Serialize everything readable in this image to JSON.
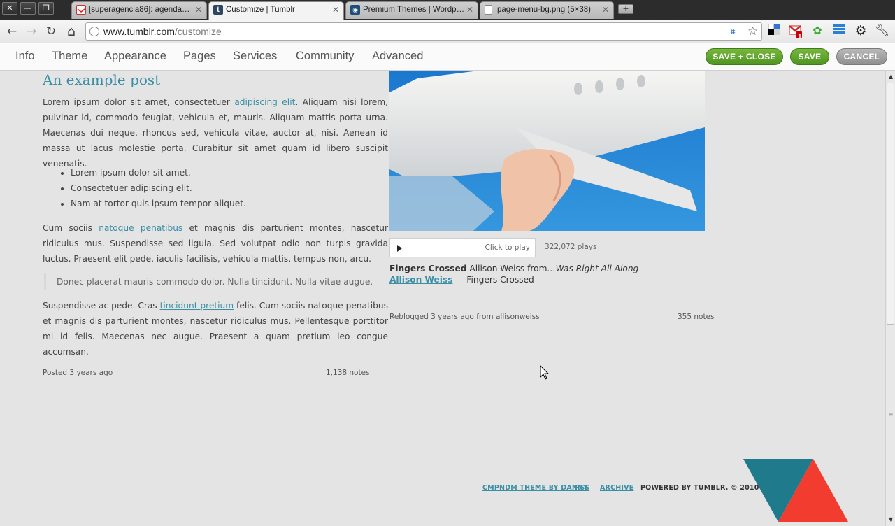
{
  "browser": {
    "tabs": [
      {
        "title": "[superagencia86]: agenda…",
        "favicon": "gmail-icon",
        "active": false
      },
      {
        "title": "Customize | Tumblr",
        "favicon": "tumblr-icon",
        "active": true
      },
      {
        "title": "Premium Themes | Wordp…",
        "favicon": "wordpress-icon",
        "active": false
      },
      {
        "title": "page-menu-bg.png (5×38)",
        "favicon": "page-icon",
        "active": false
      }
    ],
    "window_controls": {
      "close": "✕",
      "minimize": "—",
      "maximize": "❐"
    },
    "new_tab": "+",
    "nav": {
      "back": "←",
      "forward": "→",
      "reload": "↻",
      "home": "⌂"
    },
    "url_host": "www.tumblr.com",
    "url_path": "/customize",
    "gmail_badge": "1"
  },
  "menu": {
    "items": [
      "Info",
      "Theme",
      "Appearance",
      "Pages",
      "Services",
      "Community",
      "Advanced"
    ],
    "save_close": "SAVE + CLOSE",
    "save": "SAVE",
    "cancel": "CANCEL"
  },
  "post": {
    "title": "An example post",
    "p1_a": "Lorem ipsum dolor sit amet, consectetuer",
    "p1_link": "adipiscing elit",
    "p1_b": ". Aliquam nisi lorem, pulvinar id, commodo feugiat, vehicula et, mauris. Aliquam mattis porta urna. Maecenas dui neque, rhoncus sed, vehicula vitae, auctor at, nisi. Aenean id massa ut lacus molestie porta. Curabitur sit amet quam id libero suscipit venenatis.",
    "bullets": [
      "Lorem ipsum dolor sit amet.",
      "Consectetuer adipiscing elit.",
      "Nam at tortor quis ipsum tempor aliquet."
    ],
    "p2_a": "Cum sociis",
    "p2_link": "natoque penatibus",
    "p2_b": " et magnis dis parturient montes, nascetur ridiculus mus. Suspendisse sed ligula. Sed volutpat odio non turpis gravida luctus. Praesent elit pede, iaculis facilisis, vehicula mattis, tempus non, arcu.",
    "quote": "Donec placerat mauris commodo dolor. Nulla tincidunt. Nulla vitae augue.",
    "p3_a": "Suspendisse ac pede. Cras",
    "p3_link": "tincidunt pretium",
    "p3_b": " felis. Cum sociis natoque penatibus et magnis dis parturient montes, nascetur ridiculus mus. Pellentesque porttitor mi id felis. Maecenas nec augue. Praesent a quam pretium leo congue accumsan.",
    "posted": "Posted 3 years ago",
    "notes": "1,138 notes"
  },
  "audio": {
    "click_to_play": "Click to play",
    "plays": "322,072 plays",
    "track_title": "Fingers Crossed",
    "artist_from": " Allison Weiss from",
    "album": "…Was Right All Along",
    "artist_link": "Allison Weiss",
    "song_suffix": " — Fingers Crossed",
    "reblogged": "Reblogged 3 years ago from allisonweiss",
    "notes": "355 notes"
  },
  "footer": {
    "theme_credit": "CMPNDM THEME BY DANNY",
    "rss": "RSS",
    "archive": "ARCHIVE",
    "powered": "POWERED BY TUMBLR. © 2010"
  },
  "colors": {
    "accent": "#3b8fa4",
    "save_green": "#5a9e2b",
    "cancel_grey": "#9a9a9a",
    "logo_teal": "#1f7b8c",
    "logo_red": "#f23c30"
  }
}
